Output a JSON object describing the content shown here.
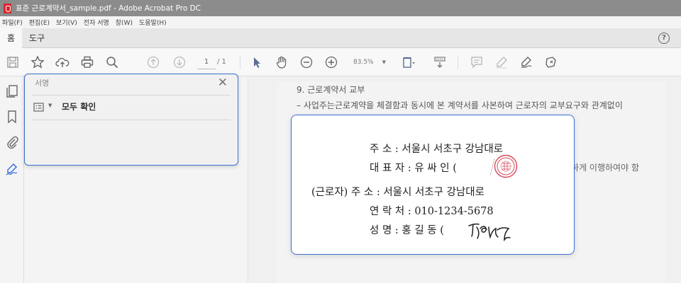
{
  "window": {
    "title": "표준 근로계약서_sample.pdf - Adobe Acrobat Pro DC"
  },
  "menu": [
    "파일(F)",
    "편집(E)",
    "보기(V)",
    "전자 서명",
    "창(W)",
    "도움말(H)"
  ],
  "tabs": [
    {
      "label": "홈",
      "active": true
    },
    {
      "label": "도구",
      "active": false
    }
  ],
  "help_label": "?",
  "toolbar": {
    "page_current": "1",
    "page_total": "/ 1",
    "zoom": "83.5%",
    "icons": [
      "save-icon",
      "bookmark-star-icon",
      "cloud-upload-icon",
      "print-icon",
      "magnify-icon",
      "page-up-icon",
      "page-down-icon",
      "zoom-out-icon",
      "zoom-in-icon",
      "select-arrow-icon",
      "hand-icon",
      "fit-page-icon",
      "scroll-mode-icon",
      "comment-icon",
      "highlight-pen-icon",
      "fill-sign-icon",
      "sign-tools-icon"
    ]
  },
  "siderail": {
    "icons": [
      "pages-icon",
      "bookmark-icon",
      "attachment-icon",
      "signature-icon"
    ]
  },
  "signature_panel": {
    "title": "서명",
    "verify_all_label": "모두 확인",
    "close_glyph": "✕"
  },
  "document": {
    "heading": "9. 근로계약서 교부",
    "line1": "– 사업주는근로계약을 체결함과 동시에 본 계약서를 사본하여 근로자의 교부요구와 관계없이",
    "line_tail": "실하게 이행하여야 함"
  },
  "contract_card": {
    "employer_address": "주 소 : 서울시 서초구 강남대로",
    "representative": "대 표 자 : 유 싸 인 (",
    "worker_address": "(근로자) 주 소 : 서울시 서초구 강남대로",
    "contact": "연 락 처 : 010-1234-5678",
    "name_row": "성 명 : 홍 길 동 (",
    "stamp_color": "#d9475a",
    "accent_color": "#3b6fd6"
  }
}
